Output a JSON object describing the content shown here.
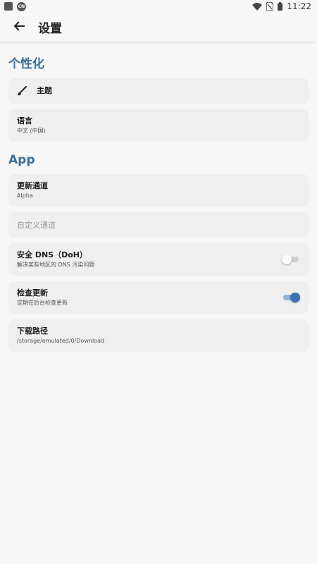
{
  "status_bar": {
    "time": "11:22",
    "icons": [
      "notification-square-icon",
      "app-badge-icon",
      "wifi-icon",
      "no-sim-icon",
      "battery-icon"
    ],
    "badge_text": "CN"
  },
  "app_bar": {
    "title": "设置",
    "back_icon": "arrow-left-icon"
  },
  "sections": {
    "personalization": {
      "title": "个性化",
      "theme": {
        "label": "主题",
        "icon": "brush-icon"
      },
      "language": {
        "label": "语言",
        "value": "中文 (中国)"
      }
    },
    "app": {
      "title": "App",
      "update_channel": {
        "label": "更新通道",
        "value": "Alpha"
      },
      "custom_channel": {
        "placeholder": "自定义通道"
      },
      "secure_dns": {
        "label": "安全 DNS（DoH）",
        "description": "解决某些地区的 DNS 污染问题",
        "enabled": false
      },
      "check_updates": {
        "label": "检查更新",
        "description": "定期在后台检查更新",
        "enabled": true
      },
      "download_path": {
        "label": "下载路径",
        "value": "/storage/emulated/0/Download"
      }
    }
  },
  "colors": {
    "accent": "#3b6f9a",
    "toggle_on": "#3b73b2",
    "card_bg": "#efefef",
    "page_bg": "#f7f7f7"
  }
}
